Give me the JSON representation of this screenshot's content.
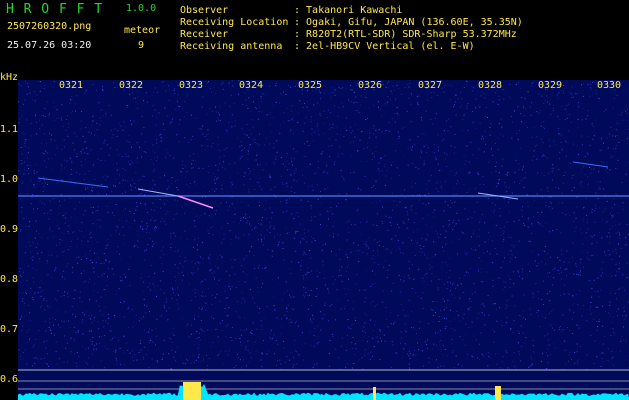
{
  "header": {
    "app_title": "H R O F F T",
    "version": "1.0.0",
    "filename": "2507260320.png",
    "datetime": "25.07.26 03:20",
    "category_label": "meteor",
    "category_count": "9",
    "info_labels": [
      "Observer",
      "Receiving Location",
      "Receiver",
      "Receiving antenna"
    ],
    "info_values": [
      ": Takanori Kawachi",
      ": Ogaki, Gifu, JAPAN (136.60E, 35.35N)",
      ": R820T2(RTL-SDR) SDR-Sharp 53.372MHz",
      ": 2el-HB9CV Vertical (el. E-W)"
    ]
  },
  "spectrogram": {
    "y_unit": "kHz",
    "y_ticks": [
      "1.1",
      "1.0",
      "0.9",
      "0.8",
      "0.7",
      "0.6"
    ],
    "x_ticks": [
      "0321",
      "0322",
      "0323",
      "0324",
      "0325",
      "0326",
      "0327",
      "0328",
      "0329",
      "0330"
    ],
    "carrier_khz": 0.968,
    "background_color": "#000a5a",
    "accent_color": "#ffe84a",
    "trace_color": "#00e5ff"
  }
}
